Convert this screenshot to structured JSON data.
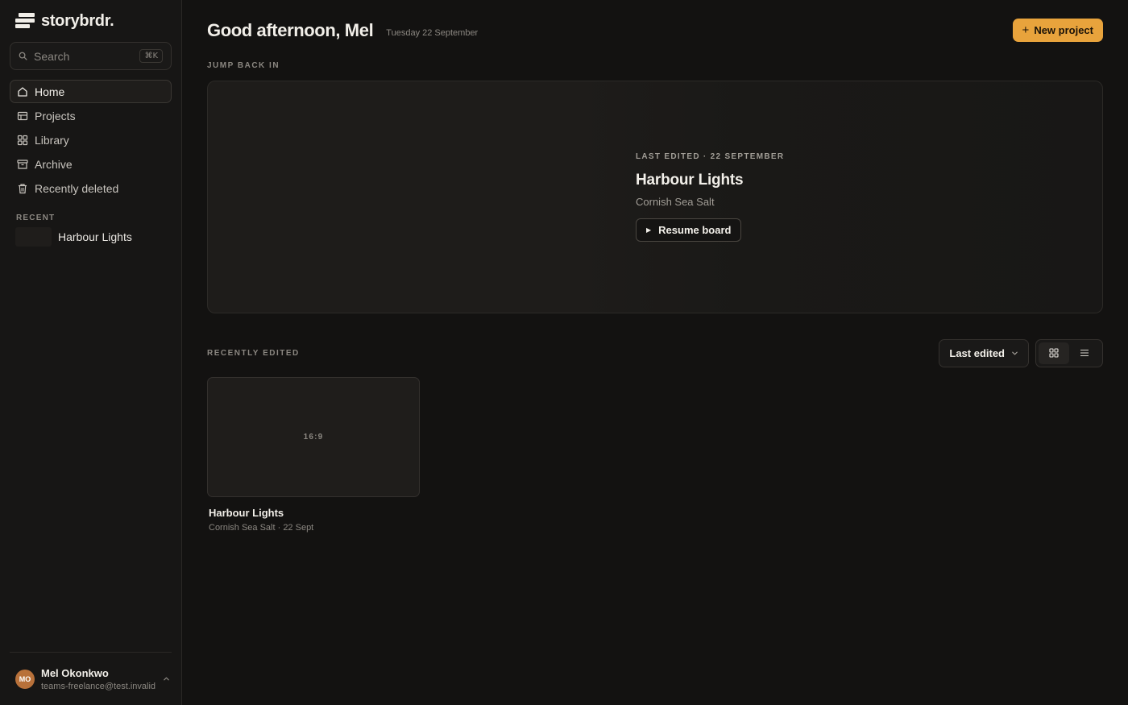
{
  "brand": {
    "name": "storybrdr."
  },
  "search": {
    "placeholder": "Search",
    "shortcut": "⌘K"
  },
  "nav": [
    {
      "label": "Home",
      "icon": "home-icon",
      "active": true
    },
    {
      "label": "Projects",
      "icon": "projects-icon",
      "active": false
    },
    {
      "label": "Library",
      "icon": "library-icon",
      "active": false
    },
    {
      "label": "Archive",
      "icon": "archive-icon",
      "active": false
    },
    {
      "label": "Recently deleted",
      "icon": "trash-icon",
      "active": false
    }
  ],
  "recent": {
    "label": "RECENT",
    "items": [
      {
        "label": "Harbour Lights"
      }
    ]
  },
  "user": {
    "initials": "MO",
    "name": "Mel Okonkwo",
    "email": "teams-freelance@test.invalid"
  },
  "header": {
    "greeting": "Good afternoon, Mel",
    "date": "Tuesday 22 September",
    "new_project": "New project"
  },
  "jump_back": {
    "label": "JUMP BACK IN",
    "meta": "LAST EDITED · 22 SEPTEMBER",
    "title": "Harbour Lights",
    "subtitle": "Cornish Sea Salt",
    "resume": "Resume board"
  },
  "recently_edited": {
    "label": "RECENTLY EDITED",
    "sort": "Last edited",
    "view": "grid",
    "cards": [
      {
        "ratio": "16:9",
        "title": "Harbour Lights",
        "subtitle": "Cornish Sea Salt · 22 Sept"
      }
    ]
  },
  "colors": {
    "accent": "#e8a33c",
    "background": "#131211",
    "sidebar": "#171615",
    "avatar": "#b8713a"
  }
}
